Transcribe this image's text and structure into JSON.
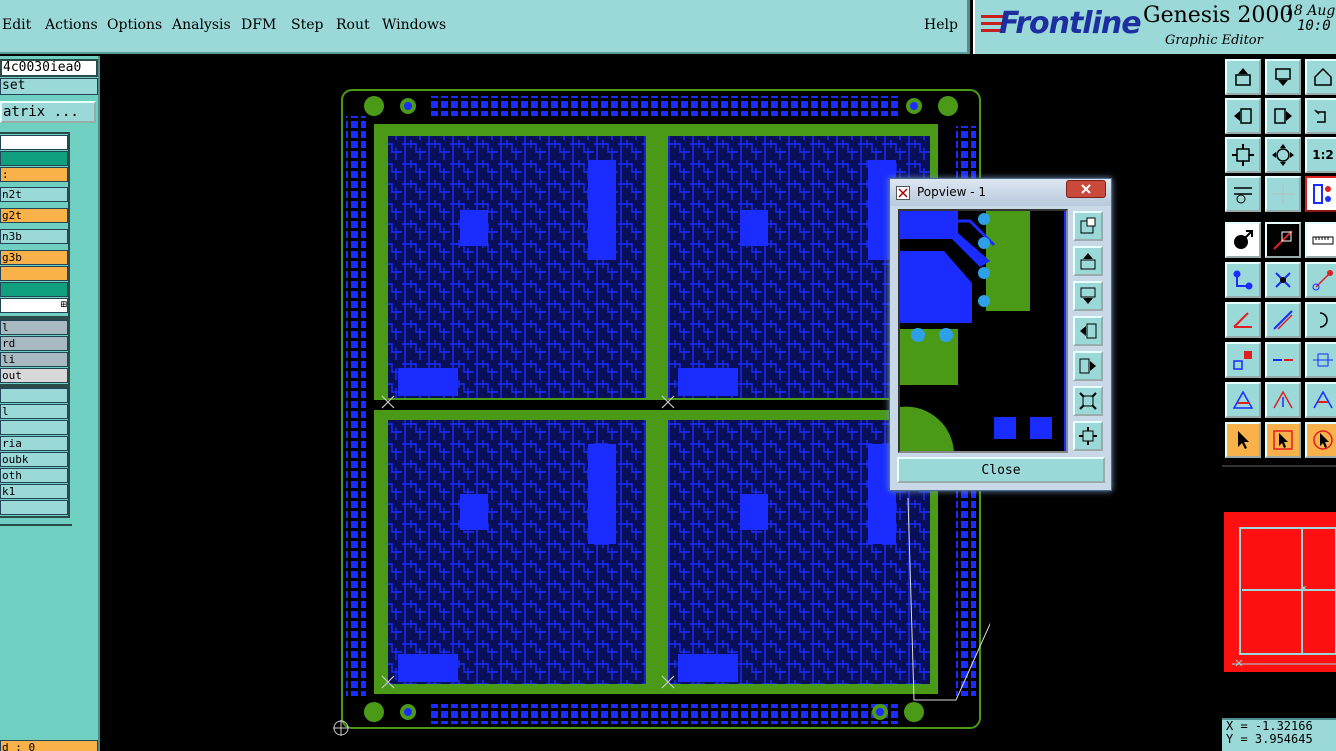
{
  "menu": {
    "items": [
      "Edit",
      "Actions",
      "Options",
      "Analysis",
      "DFM",
      "Step",
      "Rout",
      "Windows"
    ],
    "help": "Help"
  },
  "brand": {
    "logo": "Frontline",
    "product": "Genesis 2000",
    "subtitle": "Graphic Editor",
    "date": "18 Aug",
    "time": "10:0"
  },
  "left_panel": {
    "job": "4c0030iea0",
    "step": "set",
    "matrix_button": "atrix ...",
    "layers": [
      {
        "label": "",
        "color": "#ffffff"
      },
      {
        "label": "",
        "color": "#10a080"
      },
      {
        "label": ":",
        "color": "#f9b24a"
      },
      {
        "label": "n2t",
        "color": "#9bd8d8"
      },
      {
        "label": "g2t",
        "color": "#f9b24a"
      },
      {
        "label": "n3b",
        "color": "#9bd8d8"
      },
      {
        "label": "g3b",
        "color": "#f9b24a"
      },
      {
        "label": "",
        "color": "#f9b24a"
      },
      {
        "label": "",
        "color": "#10a080"
      },
      {
        "label": "",
        "color": "#ffffff"
      }
    ],
    "group2": [
      "l",
      "rd",
      "li",
      "out"
    ],
    "group3": [
      "",
      "l",
      "",
      "ria",
      "oubk",
      "oth",
      "k1",
      ""
    ],
    "status": "d : 0"
  },
  "popview": {
    "title": "Popview - 1",
    "close_label": "Close",
    "buttons": [
      "zoom-in-icon",
      "page-up-icon",
      "page-down-icon",
      "page-left-icon",
      "page-right-icon",
      "fit-all-icon",
      "fit-window-icon"
    ]
  },
  "toolbar_icons": [
    [
      "home-up-icon",
      "home-down-icon",
      "home-icon"
    ],
    [
      "pan-left-icon",
      "pan-right-icon",
      "rotate-icon"
    ],
    [
      "zoom-fit-icon",
      "zoom-center-icon",
      "scale-1-2-icon"
    ],
    [
      "snap-icon",
      "grid-icon",
      "pcb-icon"
    ],
    [
      "circle-arrow-icon",
      "measure-icon",
      "ruler-icon"
    ],
    [
      "net-icon",
      "cross-icon",
      "point-icon"
    ],
    [
      "angle-icon",
      "line-icon",
      "arc-icon"
    ],
    [
      "move-icon",
      "split-icon",
      "dimension-icon"
    ],
    [
      "triangle-icon",
      "triangle-arrow-icon",
      "triangle-up-icon"
    ],
    [
      "select-icon",
      "select-box-icon",
      "select-circle-icon"
    ]
  ],
  "coords": {
    "x": "X = -1.32166",
    "y": "Y =  3.954645"
  },
  "colors": {
    "copper_blue": "#1a2cff",
    "mask_green": "#4a9a18",
    "panel_cyan": "#9bd8d8",
    "layer_orange": "#f9b24a",
    "thumb_red": "#ff1010"
  }
}
